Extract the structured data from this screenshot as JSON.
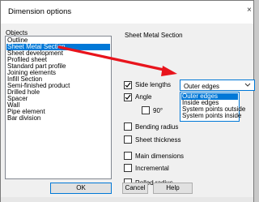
{
  "dialog": {
    "title": "Dimension options",
    "close_glyph": "×"
  },
  "objects": {
    "label": "Objects",
    "items": [
      "Outline",
      "Sheet Metal Section",
      "Sheet development",
      "Profiled sheet",
      "Standard part profile",
      "Joining elements",
      "Infill Section",
      "Semi-finished product",
      "Drilled hole",
      "Spacer",
      "Wall",
      "Pipe element",
      "Bar division"
    ],
    "selected": "Sheet Metal Section"
  },
  "section": {
    "title": "Sheet Metal Section",
    "options": {
      "side_lengths": {
        "label": "Side lengths",
        "checked": true
      },
      "angle": {
        "label": "Angle",
        "checked": true
      },
      "ninety": {
        "label": "90°",
        "checked": false
      },
      "bending_radius": {
        "label": "Bending radius",
        "checked": false
      },
      "sheet_thickness": {
        "label": "Sheet thickness",
        "checked": false
      },
      "main_dimensions": {
        "label": "Main dimensions",
        "checked": false
      },
      "incremental": {
        "label": "Incremental",
        "checked": false
      },
      "rolled_radius": {
        "label": "Rolled radius",
        "checked": false
      }
    },
    "dropdown": {
      "value": "Outer edges",
      "options": [
        "Outer edges",
        "Inside edges",
        "System points outside",
        "System points inside"
      ],
      "highlighted": "Outer edges"
    }
  },
  "buttons": {
    "ok": "OK",
    "cancel": "Cancel",
    "help": "Help"
  },
  "colors": {
    "selection": "#0078d7",
    "arrow": "#e8141c"
  }
}
